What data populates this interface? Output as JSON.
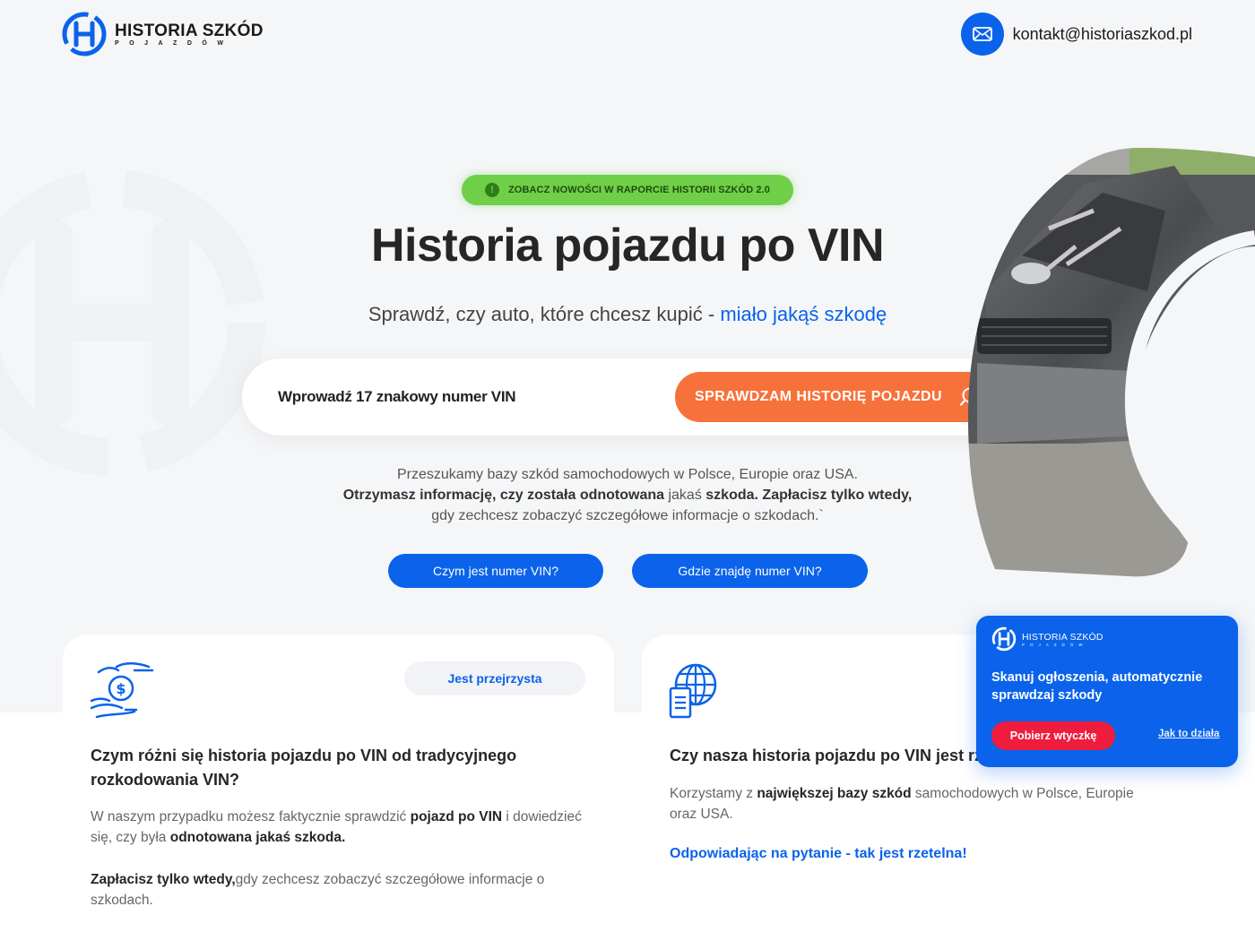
{
  "header": {
    "logo_title": "HISTORIA SZKÓD",
    "logo_subtitle": "POJAZDÓW",
    "contact_email": "kontakt@historiaszkod.pl"
  },
  "hero": {
    "badge": "ZOBACZ NOWOŚCI W RAPORCIE HISTORII SZKÓD 2.0",
    "title": "Historia pojazdu po VIN",
    "subtitle_prefix": "Sprawdź, czy auto, które chcesz kupić - ",
    "subtitle_highlight": "miało jakąś szkodę",
    "search": {
      "placeholder": "Wprowadź 17 znakowy numer VIN",
      "value": "",
      "button_label": "SPRAWDZAM HISTORIĘ POJAZDU"
    },
    "info": {
      "line1": "Przeszukamy bazy szkód samochodowych w Polsce, Europie oraz USA.",
      "line2_bold1": "Otrzymasz informację, czy została odnotowana",
      "line2_plain": " jakaś ",
      "line2_bold2": "szkoda. Zapłacisz tylko wtedy,",
      "line3": "gdy zechcesz zobaczyć szczegółowe informacje o szkodach.`"
    },
    "buttons": {
      "what_is_vin": "Czym jest numer VIN?",
      "where_vin": "Gdzie znajdę numer VIN?"
    }
  },
  "cards": {
    "card1": {
      "pill": "Jest przejrzysta",
      "title": "Czym różni się historia pojazdu po VIN od tradycyjnego rozkodowania VIN?",
      "p1_a": "W naszym przypadku możesz faktycznie sprawdzić ",
      "p1_b": "pojazd po VIN",
      "p1_c": " i dowiedzieć się, czy była ",
      "p1_d": "odnotowana jakaś szkoda.",
      "p2_a": "Zapłacisz tylko wtedy,",
      "p2_b": "gdy zechcesz zobaczyć szczegółowe informacje o szkodach."
    },
    "card2": {
      "title": "Czy nasza historia pojazdu po VIN jest rz",
      "p1_a": "Korzystamy z ",
      "p1_b": "największej bazy szkód",
      "p1_c": " samochodowych w Polsce, Europie oraz USA.",
      "link": "Odpowiadając na pytanie - tak jest rzetelna!"
    }
  },
  "widget": {
    "logo_title": "HISTORIA SZKÓD",
    "logo_subtitle": "POJAZDÓW",
    "text": "Skanuj ogłoszenia, automatycznie sprawdzaj szkody",
    "button": "Pobierz wtyczkę",
    "link": "Jak to działa"
  },
  "colors": {
    "brand_blue": "#0a63ea",
    "cta_orange": "#f7713a",
    "badge_green": "#6fcf48",
    "widget_red": "#ef1c3e"
  },
  "icons": [
    "logo-mark-icon",
    "mail-icon",
    "exclamation-icon",
    "search-icon",
    "money-hands-icon",
    "globe-document-icon",
    "car-photo"
  ]
}
